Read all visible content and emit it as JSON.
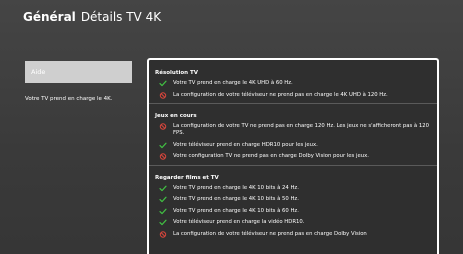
{
  "header": {
    "title_bold": "Général",
    "title_rest": "Détails TV 4K"
  },
  "left": {
    "button_label": "Aide",
    "description": "Votre TV prend en charge le 4K."
  },
  "colors": {
    "check": "#41c043",
    "cross": "#d9463c"
  },
  "sections": [
    {
      "title": "Résolution TV",
      "rows": [
        {
          "icon": "check-icon",
          "text": "Votre TV prend en charge le 4K UHD à 60 Hz."
        },
        {
          "icon": "prohibited-icon",
          "text": "La configuration de votre téléviseur ne prend pas en charge le 4K UHD à 120 Hz."
        }
      ]
    },
    {
      "title": "Jeux en cours",
      "rows": [
        {
          "icon": "prohibited-icon",
          "text": "La configuration de votre TV ne prend pas en charge 120 Hz. Les jeux ne s'afficheront pas à 120 FPS."
        },
        {
          "icon": "check-icon",
          "text": "Votre téléviseur prend en charge HDR10 pour les jeux."
        },
        {
          "icon": "prohibited-icon",
          "text": "Votre configuration TV ne prend pas en charge Dolby Vision pour les jeux."
        }
      ]
    },
    {
      "title": "Regarder films et TV",
      "rows": [
        {
          "icon": "check-icon",
          "text": "Votre TV prend en charge le 4K 10 bits à 24 Hz."
        },
        {
          "icon": "check-icon",
          "text": "Votre TV prend en charge le 4K 10 bits à 50 Hz."
        },
        {
          "icon": "check-icon",
          "text": "Votre TV prend en charge le 4K 10 bits à 60 Hz."
        },
        {
          "icon": "check-icon",
          "text": "Votre téléviseur prend en charge la vidéo HDR10."
        },
        {
          "icon": "prohibited-icon",
          "text": "La configuration de votre téléviseur ne prend pas en charge Dolby Vision"
        }
      ]
    }
  ]
}
